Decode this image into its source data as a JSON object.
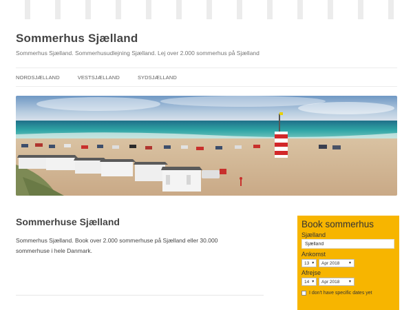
{
  "site": {
    "title": "Sommerhus Sjælland",
    "tagline": "Sommerhus Sjælland. Sommerhusudlejning Sjælland. Lej over 2.000 sommerhus på Sjælland"
  },
  "nav": {
    "items": [
      {
        "label": "NORDSJÆLLAND"
      },
      {
        "label": "VESTSJÆLLAND"
      },
      {
        "label": "SYDSJÆLLAND"
      }
    ]
  },
  "main": {
    "title": "Sommerhuse Sjælland",
    "text": "Sommerhus Sjælland. Book over 2.000 sommerhuse på Sjælland eller 30.000 sommerhuse i hele Danmark."
  },
  "booking": {
    "title": "Book sommerhus",
    "region_label": "Sjælland",
    "region_value": "Sjælland",
    "arrival_label": "Ankomst",
    "arrival_day": "13",
    "arrival_month": "Apr 2018",
    "departure_label": "Afrejse",
    "departure_day": "14",
    "departure_month": "Apr 2018",
    "no_dates_label": "I don't have specific dates yet",
    "accent_color": "#f7b500"
  }
}
